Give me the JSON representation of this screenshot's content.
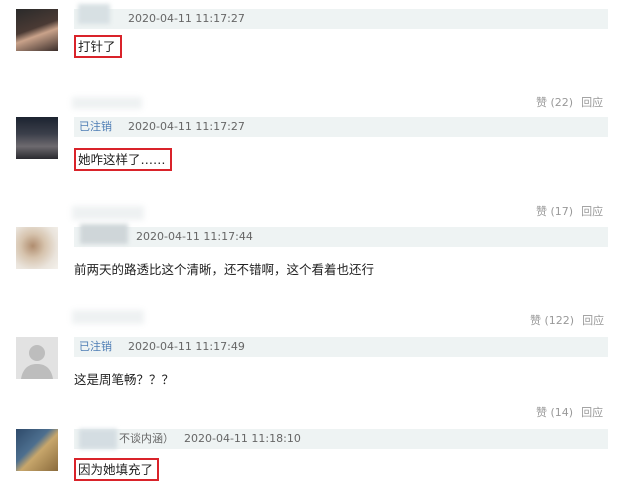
{
  "comments": [
    {
      "user_suffix": "",
      "time": "2020-04-11 11:17:27",
      "text": "打针了",
      "highlight": true
    },
    {
      "user_suffix": "已注销",
      "time": "2020-04-11 11:17:27",
      "text": "她咋这样了……",
      "highlight": true,
      "likes": "赞 (22)",
      "reply": "回应"
    },
    {
      "user_suffix": "",
      "time": "2020-04-11 11:17:44",
      "text": "前两天的路透比这个清晰，还不错啊，这个看着也还行",
      "highlight": false,
      "likes": "赞 (17)",
      "reply": "回应"
    },
    {
      "user_suffix": "已注销",
      "time": "2020-04-11 11:17:49",
      "text": "这是周笔畅？？？",
      "highlight": false,
      "likes": "赞 (122)",
      "reply": "回应"
    },
    {
      "user_suffix": "不谈内涵）",
      "time": "2020-04-11 11:18:10",
      "text": "因为她填充了",
      "highlight": true,
      "likes": "赞 (14)",
      "reply": "回应"
    }
  ],
  "colors": {
    "highlight": "#d9232a",
    "meta_bg": "#eef3f3",
    "deleted_link": "#4f7eb5"
  }
}
